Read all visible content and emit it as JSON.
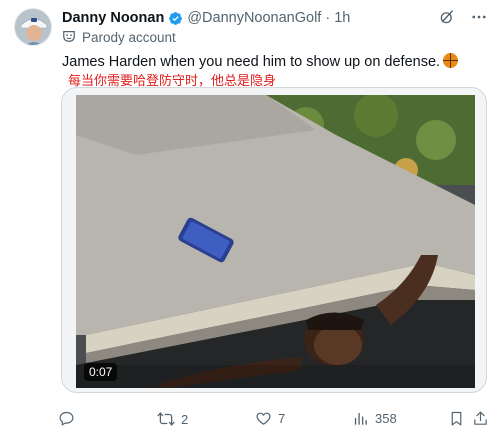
{
  "author": {
    "display_name": "Danny Noonan",
    "handle": "@DannyNoonanGolf",
    "time": "1h",
    "badge": "Parody account"
  },
  "tweet": {
    "text": "James Harden when you need him to show up on defense.",
    "overlay_caption": "每当你需要哈登防守时，他总是隐身"
  },
  "video": {
    "duration": "0:07"
  },
  "actions": {
    "replies": "",
    "retweets": "2",
    "likes": "7",
    "views": "358"
  },
  "icons": {
    "verified": "verified-badge-icon",
    "grok": "grok-icon",
    "more": "more-options-icon",
    "parody": "parody-mask-icon",
    "basketball": "basketball-emoji-icon"
  },
  "colors": {
    "verified": "#1d9bf0",
    "overlay_caption": "#e0201f",
    "secondary_text": "#536471"
  }
}
